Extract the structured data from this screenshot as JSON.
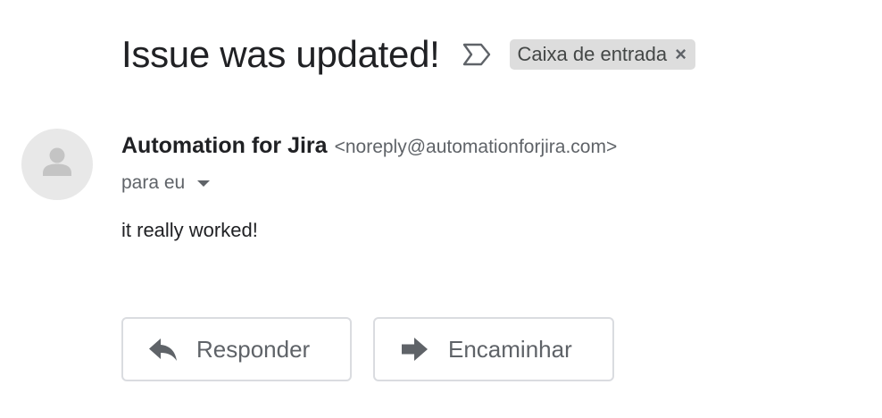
{
  "email": {
    "subject": "Issue was updated!",
    "label_chip": "Caixa de entrada",
    "label_close": "×",
    "sender_name": "Automation for Jira",
    "sender_email": "<noreply@automationforjira.com>",
    "recipient": "para eu",
    "body": "it really worked!"
  },
  "actions": {
    "reply_label": "Responder",
    "forward_label": "Encaminhar"
  },
  "icons": {
    "importance": "importance-marker-icon",
    "avatar": "person-icon",
    "recipient_toggle": "caret-down-icon",
    "reply": "reply-icon",
    "forward": "forward-icon"
  },
  "colors": {
    "chip_background": "#dddddd",
    "avatar_background": "#e8e8e8",
    "icon_gray": "#5f6368"
  }
}
